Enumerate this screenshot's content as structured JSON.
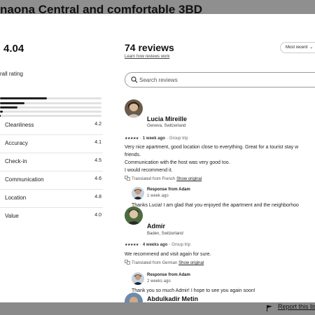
{
  "page": {
    "title": "naona Central and comfortable 3BD"
  },
  "ratings": {
    "overall_score": "4.04",
    "overall_label": "rall rating",
    "distribution": [
      0.46,
      0.24,
      0.17,
      0.03,
      0.01
    ],
    "categories": [
      {
        "label": "Cleanliness",
        "value": "4.2"
      },
      {
        "label": "Accuracy",
        "value": "4.1"
      },
      {
        "label": "Check-in",
        "value": "4.5"
      },
      {
        "label": "Communication",
        "value": "4.6"
      },
      {
        "label": "Location",
        "value": "4.8"
      },
      {
        "label": "Value",
        "value": "4.0"
      }
    ]
  },
  "reviews_header": {
    "count_label": "74 reviews",
    "learn_link": "Learn how reviews work",
    "sort_label": "Most recent",
    "search_placeholder": "Search reviews"
  },
  "reviews": [
    {
      "name": "Lucia Mireille",
      "location": "Geneva, Switzerland",
      "stars": "★★★★★",
      "when": "1 week ago",
      "trip": "Group trip",
      "lines": [
        "Very nice apartment, good location close to everything. Great for a tourist stay w",
        "friends.",
        "Communication with the host was very good too.",
        "I would recommend it."
      ],
      "translated": "Translated from French",
      "show_original": "Show original",
      "response": {
        "title": "Response from Adam",
        "date": "1 week ago",
        "text": "Thanks Lucia! I am glad that you enjoyed the apartment and the neighborhoo"
      }
    },
    {
      "name": "Admir",
      "location": "Baden, Switzerland",
      "stars": "★★★★★",
      "when": "4 weeks ago",
      "trip": "Group trip",
      "lines": [
        "We recommend and visit again for sure."
      ],
      "translated": "Translated from German",
      "show_original": "Show original",
      "response": {
        "title": "Response from Adam",
        "date": "2 weeks ago",
        "text": "Thank you so much Admir! I hope to see you again soon!"
      }
    },
    {
      "name": "Abdulkadir Metin"
    }
  ],
  "footer": {
    "report_link": "Report this listi"
  }
}
